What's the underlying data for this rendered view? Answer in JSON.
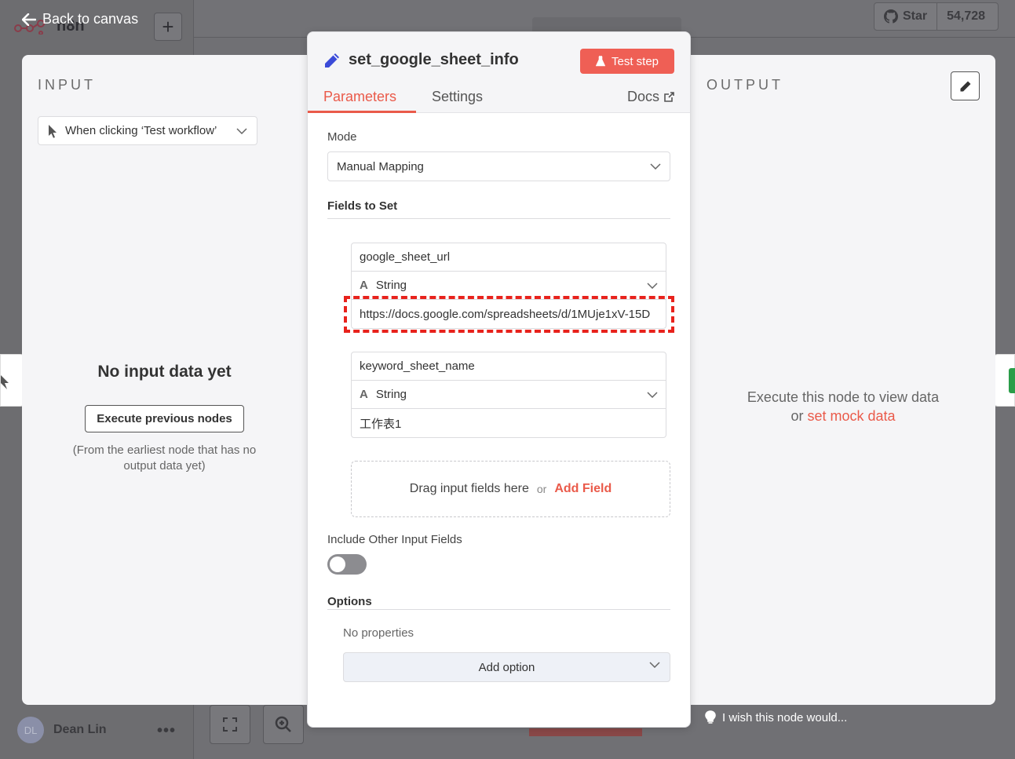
{
  "app": {
    "logo_text": "n8n",
    "back_label": "Back to canvas",
    "github": {
      "star_label": "Star",
      "star_count": "54,728"
    },
    "user": {
      "initials": "DL",
      "name": "Dean Lin",
      "more": "•••"
    },
    "feedback_text": "I wish this node would..."
  },
  "input_panel": {
    "title": "INPUT",
    "trigger_select": "When clicking ‘Test workflow’",
    "empty_title": "No input data yet",
    "execute_button": "Execute previous nodes",
    "execute_note": "(From the earliest node that has no output data yet)"
  },
  "output_panel": {
    "title": "OUTPUT",
    "message_line1": "Execute this node to view data",
    "message_or": "or",
    "mock_link": "set mock data"
  },
  "node": {
    "title": "set_google_sheet_info",
    "test_button": "Test step",
    "tabs": [
      {
        "label": "Parameters",
        "active": true
      },
      {
        "label": "Settings",
        "active": false
      }
    ],
    "docs_label": "Docs",
    "mode_label": "Mode",
    "mode_value": "Manual Mapping",
    "fields_label": "Fields to Set",
    "fields": [
      {
        "name": "google_sheet_url",
        "type": "String",
        "value": "https://docs.google.com/spreadsheets/d/1MUje1xV-15D"
      },
      {
        "name": "keyword_sheet_name",
        "type": "String",
        "value": "工作表1"
      }
    ],
    "drop_text": "Drag input fields here",
    "drop_or": "or",
    "add_field": "Add Field",
    "include_label": "Include Other Input Fields",
    "include_enabled": false,
    "options_label": "Options",
    "no_properties": "No properties",
    "add_option": "Add option"
  },
  "colors": {
    "accent": "#ea5a4a",
    "test_button": "#ef5f55",
    "highlight": "#e8221c"
  }
}
